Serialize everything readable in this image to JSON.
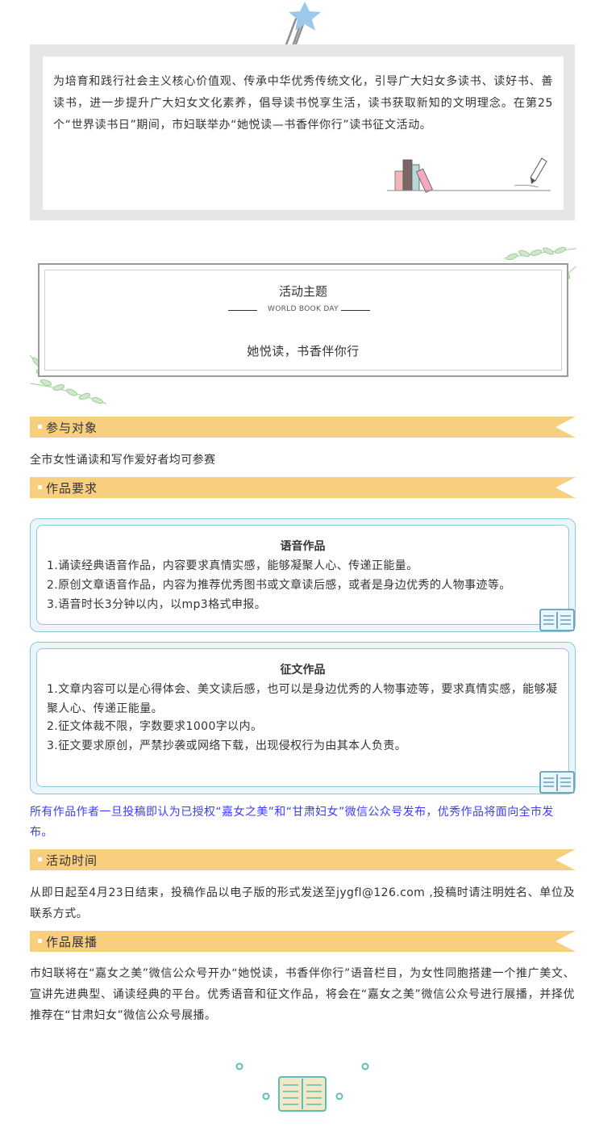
{
  "intro": {
    "text": "为培育和践行社会主义核心价值观、传承中华优秀传统文化，引导广大妇女多读书、读好书、善读书，进一步提升广大妇女文化素养，倡导读书悦享生活，读书获取新知的文明理念。在第25个“世界读书日”期间，市妇联举办“她悦读—书香伴你行”读书征文活动。"
  },
  "theme": {
    "title": "活动主题",
    "subtitle": "WORLD BOOK DAY",
    "value": "她悦读，书香伴你行"
  },
  "sections": {
    "participants": {
      "label": "参与对象",
      "text": "全市女性诵读和写作爱好者均可参赛"
    },
    "requirements": {
      "label": "作品要求"
    },
    "time": {
      "label": "活动时间",
      "text": "从即日起至4月23日结束，投稿作品以电子版的形式发送至jygfl@126.com ,投稿时请注明姓名、单位及联系方式。"
    },
    "showcase": {
      "label": "作品展播",
      "text": "市妇联将在“嘉女之美”微信公众号开办“她悦读，书香伴你行”语音栏目，为女性同胞搭建一个推广美文、宣讲先进典型、诵读经典的平台。优秀语音和征文作品，将会在“嘉女之美”微信公众号进行展播，并择优推荐在“甘肃妇女”微信公众号展播。"
    }
  },
  "voice": {
    "title": "语音作品",
    "items": [
      "1.诵读经典语音作品，内容要求真情实感，能够凝聚人心、传递正能量。",
      "2.原创文章语音作品，内容为推荐优秀图书或文章读后感，或者是身边优秀的人物事迹等。",
      "3.语音时长3分钟以内，以mp3格式申报。"
    ]
  },
  "essay": {
    "title": "征文作品",
    "items": [
      "1.文章内容可以是心得体会、美文读后感，也可以是身边优秀的人物事迹等，要求真情实感，能够凝聚人心、传递正能量。",
      "2.征文体裁不限，字数要求1000字以内。",
      "3.征文要求原创，严禁抄袭或网络下载，出现侵权行为由其本人负责。"
    ]
  },
  "notice": "所有作品作者一旦投稿即认为已授权“嘉女之美”和“甘肃妇女”微信公众号发布，优秀作品将面向全市发布。",
  "colors": {
    "section_bar": "#f8cf7e",
    "card_border": "#8fc7dc",
    "notice_text": "#3c3cff",
    "star": "#9cc8eb"
  },
  "icons": [
    "star-icon",
    "paperclip-icon",
    "books-icon",
    "pencil-icon",
    "leaves-icon",
    "open-book-icon"
  ]
}
